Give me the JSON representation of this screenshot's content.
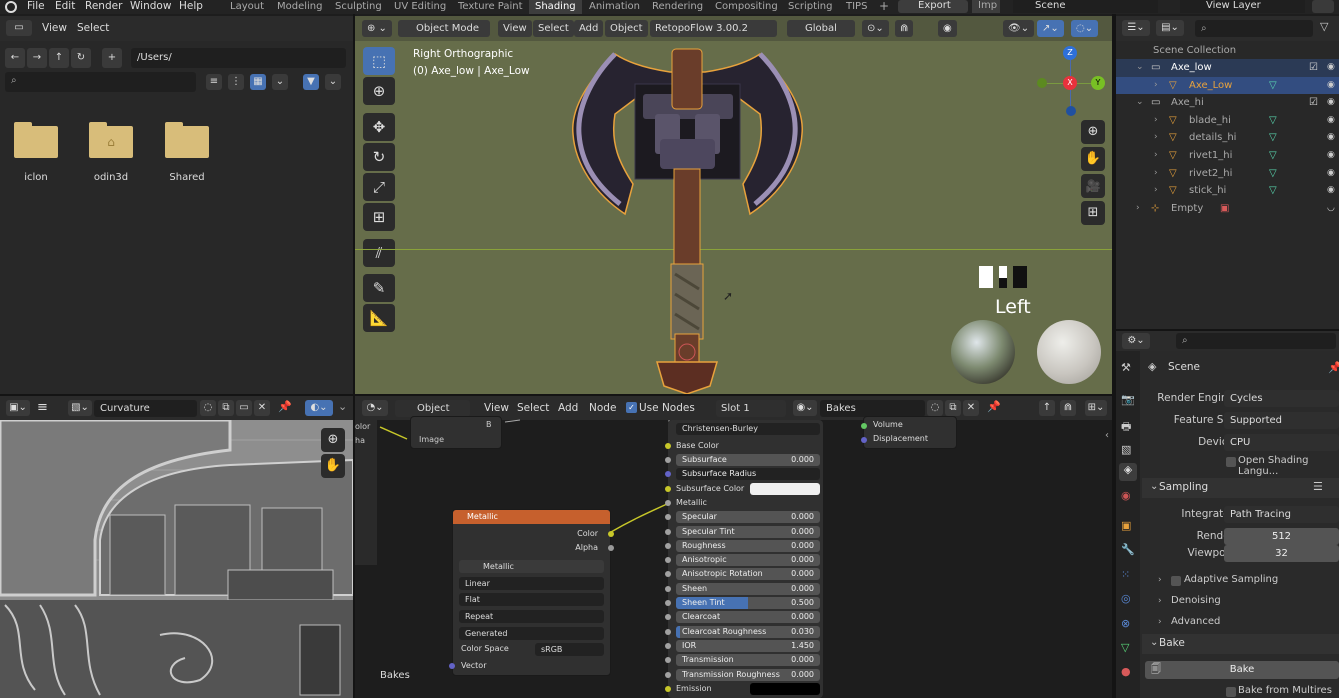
{
  "topbar": {
    "menus": [
      "File",
      "Edit",
      "Render",
      "Window",
      "Help"
    ],
    "workspaces": [
      "Layout",
      "Modeling",
      "Sculpting",
      "UV Editing",
      "Texture Paint",
      "Shading",
      "Animation",
      "Rendering",
      "Compositing",
      "Scripting",
      "TIPS"
    ],
    "active_workspace": "Shading",
    "export_label": "Export",
    "imp_label": "Imp",
    "scene": "Scene",
    "view_layer": "View Layer"
  },
  "filebrowser": {
    "menus": [
      "View",
      "Select"
    ],
    "path": "/Users/",
    "items": [
      {
        "name": "iclon",
        "home": false
      },
      {
        "name": "odin3d",
        "home": true
      },
      {
        "name": "Shared",
        "home": false
      }
    ]
  },
  "viewport": {
    "mode": "Object Mode",
    "menus": [
      "View",
      "Add",
      "Object"
    ],
    "addon": "RetopoFlow 3.00.2",
    "orientation": "Global",
    "view_name": "Right Orthographic",
    "object_info": "(0) Axe_low | Axe_Low",
    "gizmo_label": "Left",
    "gizmo_axes": {
      "z": "Z",
      "x": "X",
      "y": "Y"
    }
  },
  "outliner": {
    "collection": "Scene Collection",
    "rows": [
      {
        "label": "Axe_low",
        "indent": 0,
        "type": "collection",
        "selected": true,
        "active": false
      },
      {
        "label": "Axe_Low",
        "indent": 1,
        "type": "mesh",
        "selected": true,
        "active": true
      },
      {
        "label": "Axe_hi",
        "indent": 0,
        "type": "collection",
        "selected": false,
        "active": false
      },
      {
        "label": "blade_hi",
        "indent": 1,
        "type": "mesh",
        "selected": false,
        "active": false
      },
      {
        "label": "details_hi",
        "indent": 1,
        "type": "mesh",
        "selected": false,
        "active": false
      },
      {
        "label": "rivet1_hi",
        "indent": 1,
        "type": "mesh",
        "selected": false,
        "active": false
      },
      {
        "label": "rivet2_hi",
        "indent": 1,
        "type": "mesh",
        "selected": false,
        "active": false
      },
      {
        "label": "stick_hi",
        "indent": 1,
        "type": "mesh",
        "selected": false,
        "active": false
      },
      {
        "label": "Empty",
        "indent": 0,
        "type": "empty",
        "selected": false,
        "active": false
      }
    ]
  },
  "image_editor": {
    "image": "Curvature"
  },
  "node_editor": {
    "type": "Object",
    "menus": [
      "View",
      "Select",
      "Add",
      "Node"
    ],
    "use_nodes": "Use Nodes",
    "slot": "Slot 1",
    "material": "Bakes",
    "frame_label": "Bakes",
    "left_node": {
      "out_b": "B",
      "out_image": "Image",
      "partial_in_1": "olor",
      "partial_in_2": "ha"
    },
    "texture_node": {
      "title": "Metallic",
      "outputs": [
        "Color",
        "Alpha"
      ],
      "image": "Metallic",
      "interpolation": "Linear",
      "projection": "Flat",
      "extension": "Repeat",
      "source": "Generated",
      "color_space_label": "Color Space",
      "color_space": "sRGB",
      "input": "Vector"
    },
    "bsdf": {
      "subsurface_method": "Christensen-Burley",
      "base_color": "Base Color",
      "rows": [
        {
          "label": "Subsurface",
          "value": "0.000"
        },
        {
          "label": "Subsurface Radius",
          "value": ""
        },
        {
          "label": "Subsurface Color",
          "value": ""
        },
        {
          "label": "Metallic",
          "value": ""
        },
        {
          "label": "Specular",
          "value": "0.000"
        },
        {
          "label": "Specular Tint",
          "value": "0.000"
        },
        {
          "label": "Roughness",
          "value": "0.000"
        },
        {
          "label": "Anisotropic",
          "value": "0.000"
        },
        {
          "label": "Anisotropic Rotation",
          "value": "0.000"
        },
        {
          "label": "Sheen",
          "value": "0.000"
        },
        {
          "label": "Sheen Tint",
          "value": "0.500"
        },
        {
          "label": "Clearcoat",
          "value": "0.000"
        },
        {
          "label": "Clearcoat Roughness",
          "value": "0.030"
        },
        {
          "label": "IOR",
          "value": "1.450"
        },
        {
          "label": "Transmission",
          "value": "0.000"
        },
        {
          "label": "Transmission Roughness",
          "value": "0.000"
        },
        {
          "label": "Emission",
          "value": ""
        }
      ]
    },
    "output_node": {
      "rows": [
        "Volume",
        "Displacement"
      ]
    }
  },
  "properties": {
    "scene": "Scene",
    "render_engine_label": "Render Engine",
    "render_engine": "Cycles",
    "feature_set_label": "Feature Set",
    "feature_set": "Supported",
    "device_label": "Device",
    "device": "CPU",
    "osl": "Open Shading Langu...",
    "sampling": "Sampling",
    "integrator_label": "Integrator",
    "integrator": "Path Tracing",
    "render_label": "Render",
    "render_samples": "512",
    "viewport_label": "Viewport",
    "viewport_samples": "32",
    "adaptive": "Adaptive Sampling",
    "denoising": "Denoising",
    "advanced": "Advanced",
    "bake_header": "Bake",
    "bake_button": "Bake",
    "bake_multires": "Bake from Multires"
  },
  "colors": {
    "accent": "#4772b3",
    "orange": "#e8a23c",
    "node_header": "#c6602d"
  }
}
